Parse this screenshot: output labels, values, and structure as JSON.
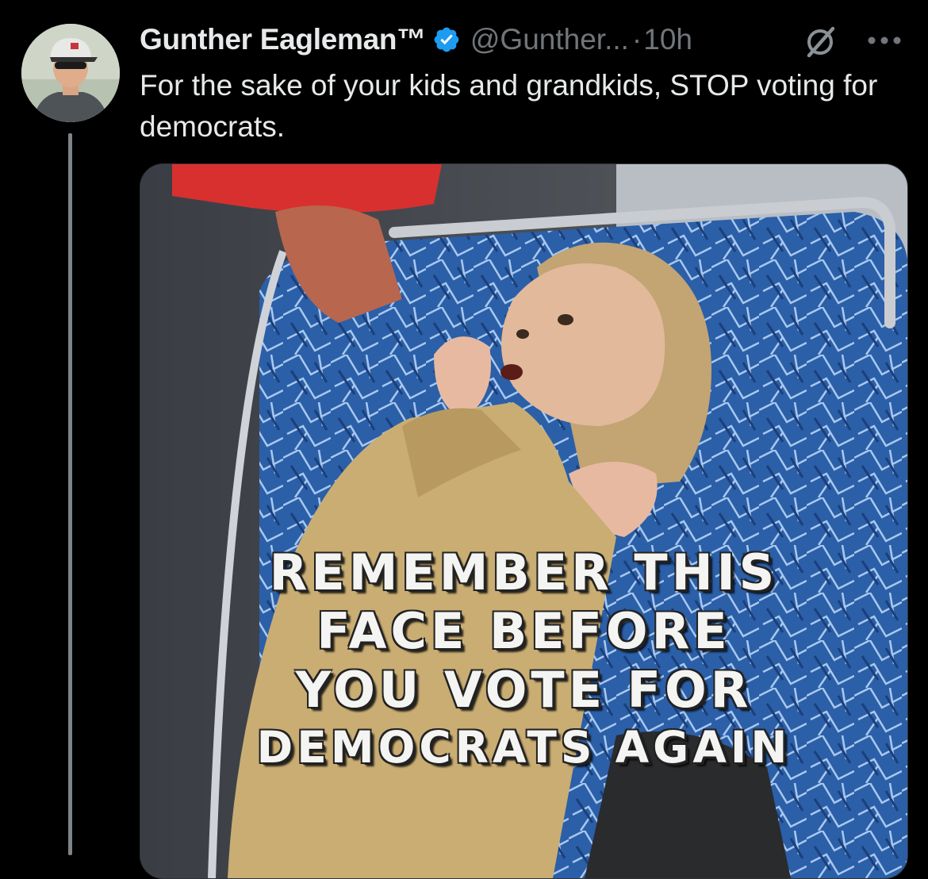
{
  "tweet": {
    "author": {
      "display_name": "Gunther Eagleman™",
      "handle": "@Gunther...",
      "verified": true,
      "avatar_icon": "profile-photo"
    },
    "separator": "·",
    "time": "10h",
    "text": "For the sake of your kids and grandkids, STOP voting for democrats.",
    "grok_icon": "grok-icon",
    "more_icon": "more-icon",
    "media": {
      "caption_lines": [
        "REMEMBER THIS",
        "FACE BEFORE",
        "YOU VOTE FOR",
        "DEMOCRATS AGAIN"
      ]
    }
  },
  "colors": {
    "background": "#000000",
    "text_primary": "#e7e9ea",
    "text_secondary": "#71767b",
    "verified_badge": "#1d9bf0",
    "thread_line": "#7e8489"
  }
}
